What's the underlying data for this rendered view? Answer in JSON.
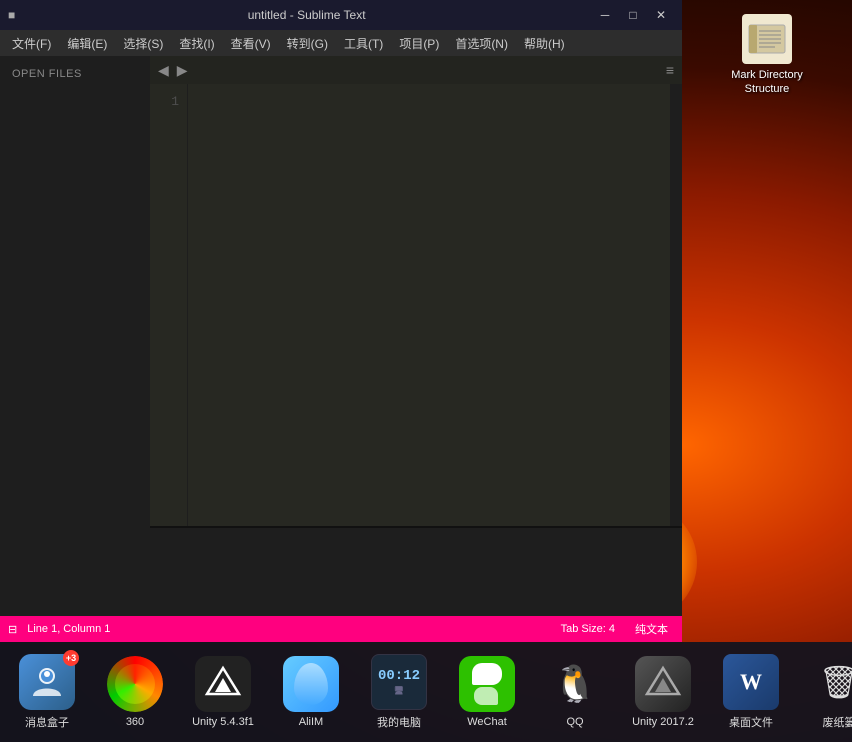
{
  "desktop": {
    "background_color": "#3a0a00"
  },
  "mark_directory": {
    "label": "Mark Directory Structure"
  },
  "sublime": {
    "title": "untitled - Sublime Text",
    "window_icon": "■",
    "menu_items": [
      {
        "label": "文件(F)"
      },
      {
        "label": "编辑(E)"
      },
      {
        "label": "选择(S)"
      },
      {
        "label": "查找(I)"
      },
      {
        "label": "查看(V)"
      },
      {
        "label": "转到(G)"
      },
      {
        "label": "工具(T)"
      },
      {
        "label": "项目(P)"
      },
      {
        "label": "首选项(N)"
      },
      {
        "label": "帮助(H)"
      }
    ],
    "sidebar_label": "OPEN FILES",
    "line_numbers": [
      "1"
    ],
    "status_bar": {
      "icon": "⊟",
      "position": "Line 1, Column 1",
      "tab_size": "Tab Size: 4",
      "encoding": "纯文本"
    }
  },
  "taskbar": {
    "items": [
      {
        "id": "contacts",
        "label": "消息盒子",
        "badge": "+3",
        "icon_type": "contacts"
      },
      {
        "id": "360",
        "label": "360",
        "badge": null,
        "icon_type": "360"
      },
      {
        "id": "unity543",
        "label": "Unity 5.4.3f1",
        "badge": null,
        "icon_type": "unity"
      },
      {
        "id": "aliim",
        "label": "AliIM",
        "badge": null,
        "icon_type": "aliim"
      },
      {
        "id": "mycomputer",
        "label": "我的电脑",
        "badge": null,
        "icon_type": "clock",
        "time": "00:12"
      },
      {
        "id": "wechat",
        "label": "WeChat",
        "badge": null,
        "icon_type": "wechat"
      },
      {
        "id": "qq",
        "label": "QQ",
        "badge": null,
        "icon_type": "qq"
      },
      {
        "id": "unity2017",
        "label": "Unity 2017.2",
        "badge": null,
        "icon_type": "unity2"
      },
      {
        "id": "word",
        "label": "桌面文件",
        "badge": null,
        "icon_type": "word"
      },
      {
        "id": "trash",
        "label": "废纸篓",
        "badge": null,
        "icon_type": "trash"
      }
    ]
  },
  "clock": {
    "time": "00:12"
  }
}
